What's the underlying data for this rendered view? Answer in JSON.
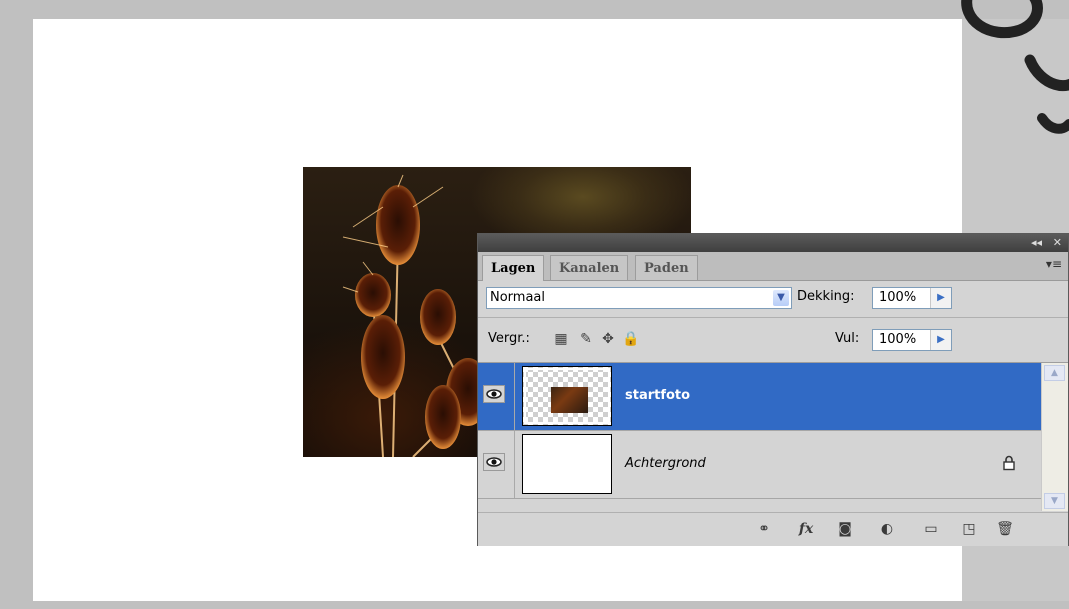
{
  "panel": {
    "tabs": [
      {
        "label": "Lagen",
        "active": true
      },
      {
        "label": "Kanalen",
        "active": false
      },
      {
        "label": "Paden",
        "active": false
      }
    ],
    "collapse_glyph": "◂◂",
    "close_glyph": "✕",
    "menu_glyph": "▾≡",
    "blend_mode": "Normaal",
    "opacity_label": "Dekking:",
    "opacity_value": "100%",
    "lock_label": "Vergr.:",
    "fill_label": "Vul:",
    "fill_value": "100%",
    "lock_icons": [
      "lock-transparent-icon",
      "lock-paint-icon",
      "lock-position-icon",
      "lock-all-icon"
    ],
    "layers": [
      {
        "name": "startfoto",
        "selected": true,
        "visible": true,
        "thumbnail": "transparent-with-photo"
      },
      {
        "name": "Achtergrond",
        "selected": false,
        "visible": true,
        "locked": true,
        "thumbnail": "white"
      }
    ],
    "bottom_icons": [
      "link-icon",
      "fx-icon",
      "mask-icon",
      "adjustment-icon",
      "folder-icon",
      "new-layer-icon",
      "trash-icon"
    ],
    "fx_text": "fx",
    "colors": {
      "selection": "#316ac5",
      "panel_bg": "#d4d4d4",
      "titlebar": "#4a4a4a"
    }
  }
}
